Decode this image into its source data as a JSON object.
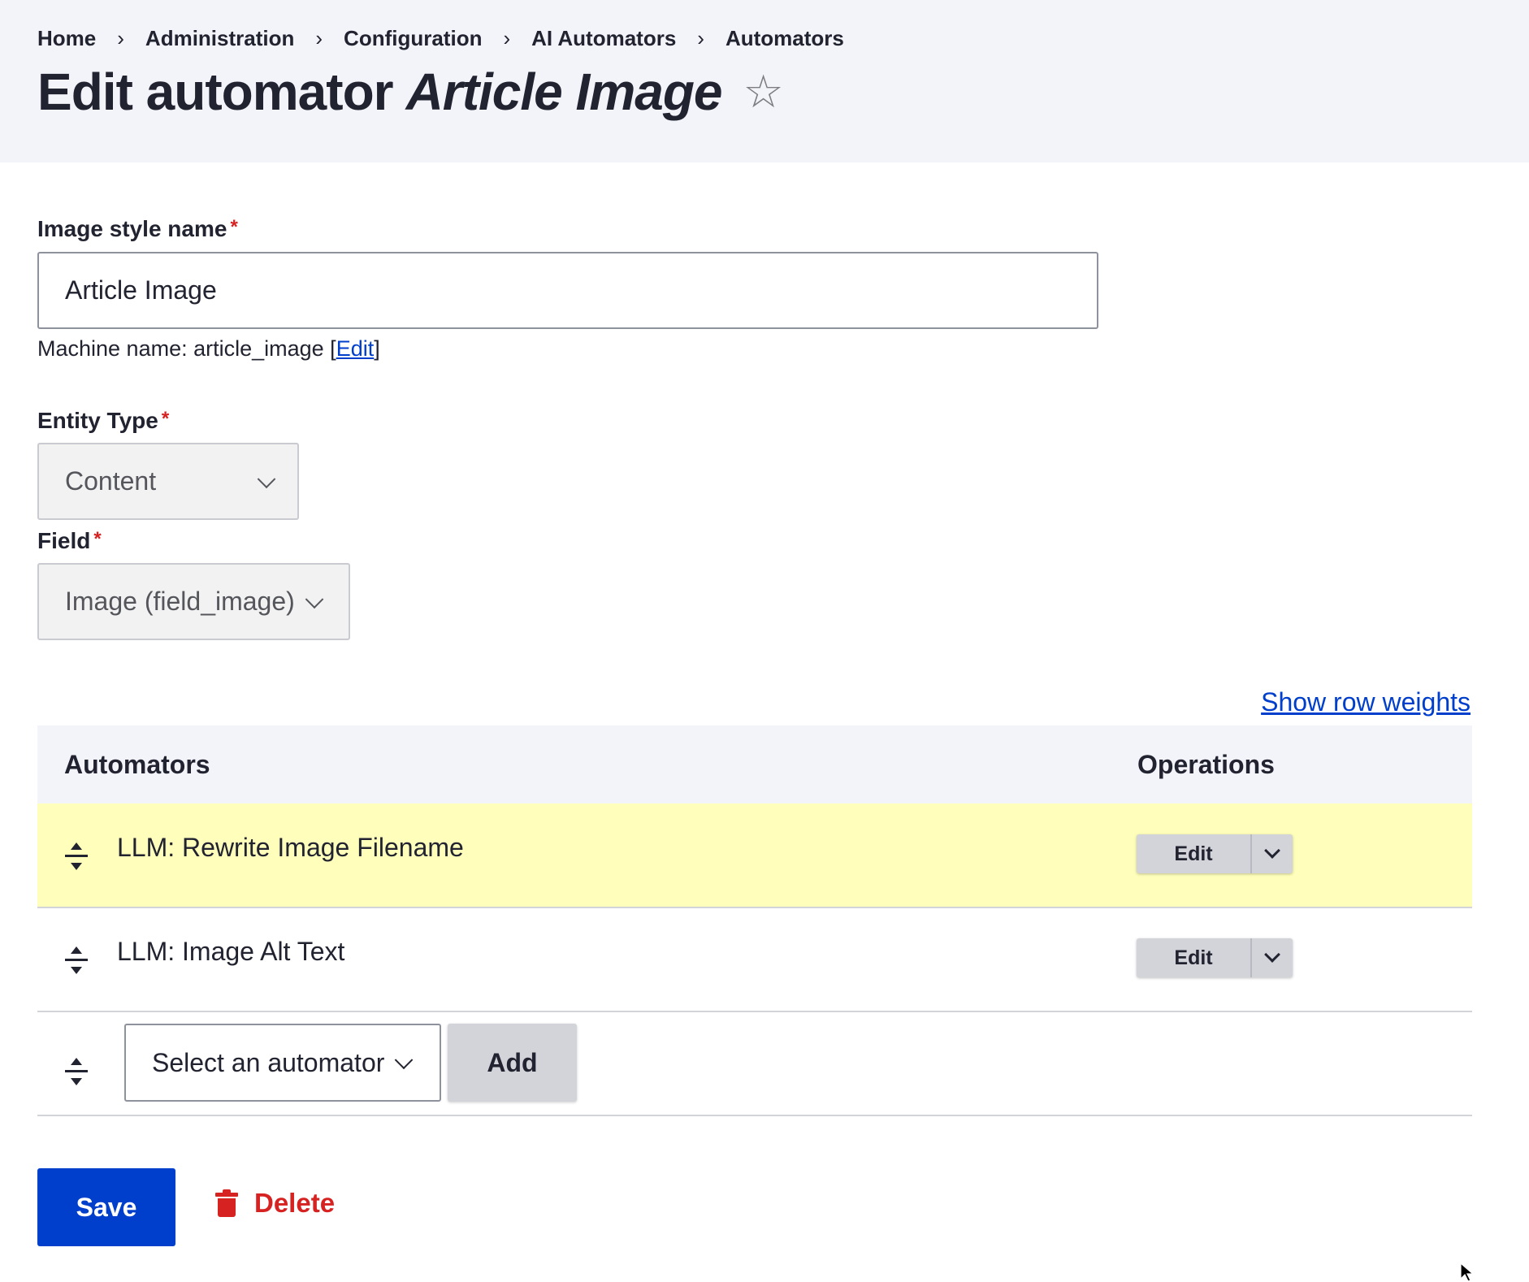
{
  "breadcrumb": [
    "Home",
    "Administration",
    "Configuration",
    "AI Automators",
    "Automators"
  ],
  "breadcrumb_separator": "›",
  "title": {
    "prefix": "Edit automator",
    "name": "Article Image",
    "favorite_icon": "star-outline-icon"
  },
  "form": {
    "image_style": {
      "label": "Image style name",
      "required_mark": "*",
      "value": "Article Image"
    },
    "machine_name": {
      "prefix": "Machine name: article_image [",
      "edit_link": "Edit",
      "suffix": "]"
    },
    "entity_type": {
      "label": "Entity Type",
      "required_mark": "*",
      "value": "Content"
    },
    "field": {
      "label": "Field",
      "required_mark": "*",
      "value": "Image (field_image)"
    }
  },
  "table": {
    "show_row_weights": "Show row weights",
    "headers": [
      "Automators",
      "Operations"
    ],
    "rows": [
      {
        "name": "LLM: Rewrite Image Filename",
        "operation": "Edit",
        "highlighted": true
      },
      {
        "name": "LLM: Image Alt Text",
        "operation": "Edit",
        "highlighted": false
      }
    ],
    "add_row": {
      "select_value": "Select an automator",
      "add_label": "Add"
    }
  },
  "actions": {
    "save": "Save",
    "delete": "Delete"
  },
  "colors": {
    "primary": "#003ecc",
    "danger": "#d72222",
    "highlight_row": "#ffffbb",
    "header_bg": "#f3f4f9"
  }
}
